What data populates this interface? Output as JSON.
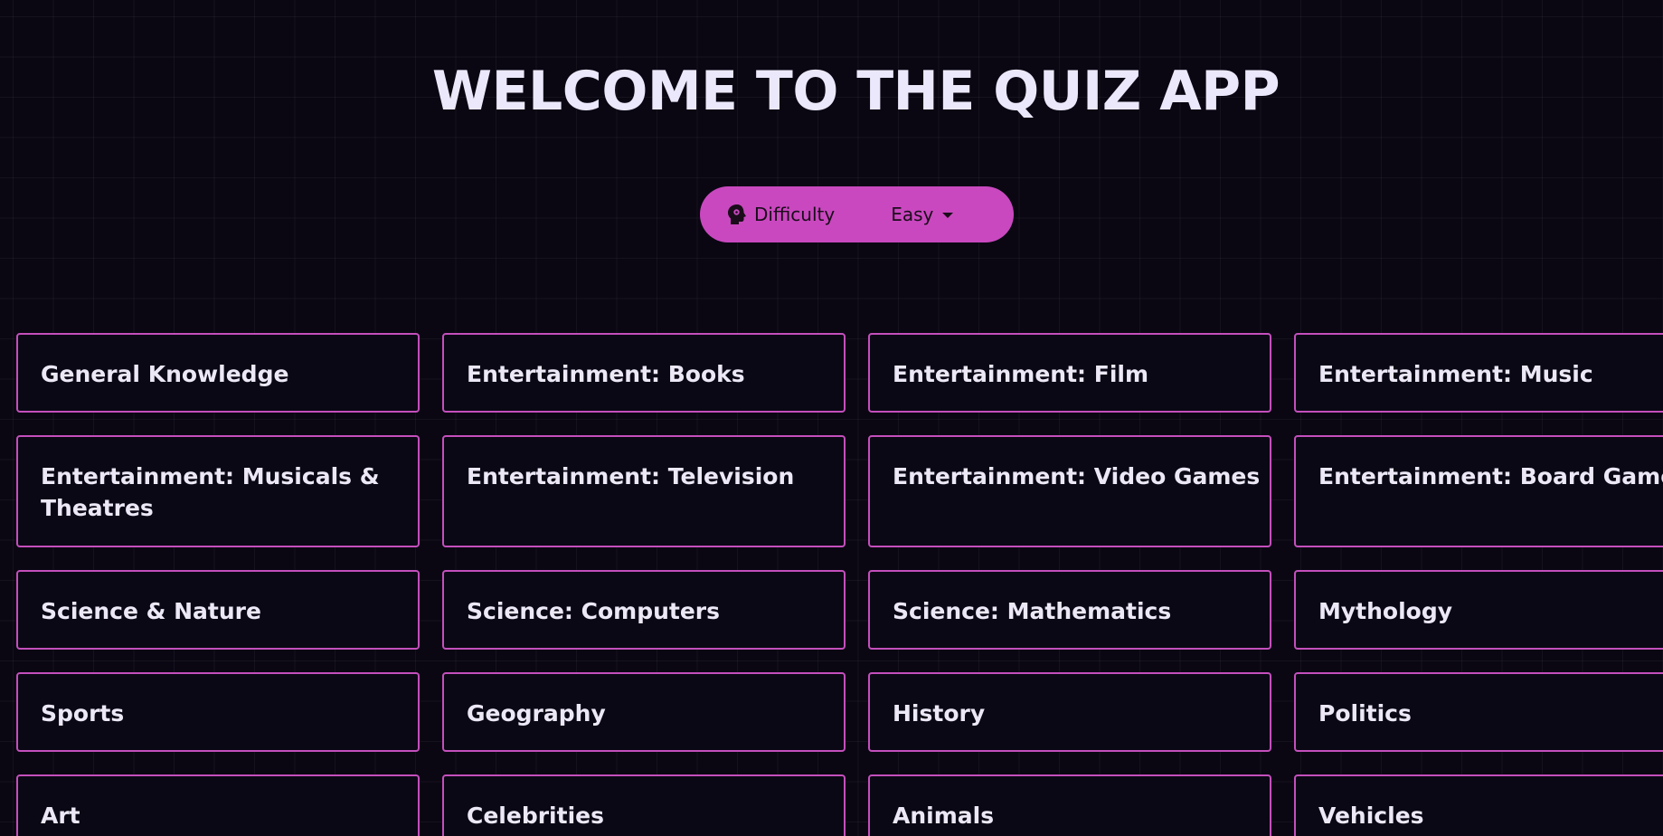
{
  "header": {
    "title": "WELCOME TO THE QUIZ APP"
  },
  "difficulty": {
    "icon": "brain-icon",
    "label": "Difficulty",
    "selected": "Easy",
    "accent_color": "#c948bf"
  },
  "categories": [
    "General Knowledge",
    "Entertainment: Books",
    "Entertainment: Film",
    "Entertainment: Music",
    "Entertainment: Musicals & Theatres",
    "Entertainment: Television",
    "Entertainment: Video Games",
    "Entertainment: Board Games",
    "Science & Nature",
    "Science: Computers",
    "Science: Mathematics",
    "Mythology",
    "Sports",
    "Geography",
    "History",
    "Politics",
    "Art",
    "Celebrities",
    "Animals",
    "Vehicles"
  ],
  "colors": {
    "background": "#0a0713",
    "card_border": "#c44fbc",
    "text": "#ece8f6"
  }
}
